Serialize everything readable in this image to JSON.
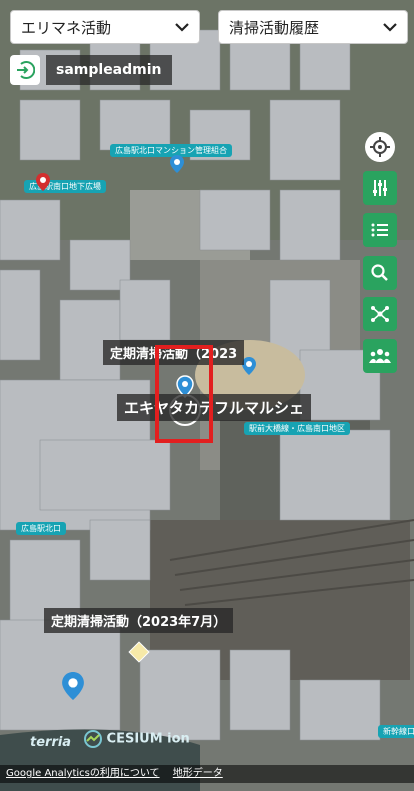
{
  "dropdowns": {
    "left": {
      "value": "エリマネ活動"
    },
    "right": {
      "value": "清掃活動履歴"
    }
  },
  "user": {
    "name": "sampleadmin"
  },
  "labels": {
    "label1": "定期清掃活動（2023",
    "label2": "エキヤタカテフルマルシェ",
    "label3": "定期清掃活動（2023年7月）"
  },
  "poi_tags": [
    "広島駅北口マンション管理組合",
    "広島駅南口地下広場",
    "駅前大橋線・広島南口地区",
    "広島駅北口",
    "新幹線口"
  ],
  "footer": {
    "analytics_link": "Google Analyticsの利用について",
    "terrain_link": "地形データ"
  },
  "credits": {
    "terria": "terria",
    "cesium": "CESIUM ion"
  },
  "colors": {
    "accent_green": "#2aa35f",
    "highlight_red": "#e21f1f",
    "poi_teal": "#17a3b3",
    "pin_blue": "#2e8fd6",
    "pin_red": "#d32f2f"
  },
  "icons": {
    "login": "login-icon",
    "locate": "crosshair-icon",
    "tools": [
      "sliders-icon",
      "list-icon",
      "search-icon",
      "network-icon",
      "group-icon"
    ]
  }
}
